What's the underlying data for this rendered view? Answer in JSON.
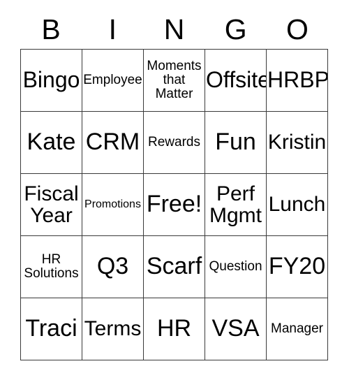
{
  "card": {
    "header_letters": [
      "B",
      "I",
      "N",
      "G",
      "O"
    ],
    "colors": {
      "background": "#ffffff",
      "text": "#000000",
      "border": "#3a3a3a"
    },
    "rows": [
      [
        {
          "text": "Bingo",
          "size": "lg"
        },
        {
          "text": "Employee",
          "size": "xs"
        },
        {
          "text": "Moments\nthat\nMatter",
          "size": "xs"
        },
        {
          "text": "Offsite",
          "size": "lg"
        },
        {
          "text": "HRBP",
          "size": "lg"
        }
      ],
      [
        {
          "text": "Kate",
          "size": "xl"
        },
        {
          "text": "CRM",
          "size": "xl"
        },
        {
          "text": "Rewards",
          "size": "xs"
        },
        {
          "text": "Fun",
          "size": "xl"
        },
        {
          "text": "Kristin",
          "size": "md"
        }
      ],
      [
        {
          "text": "Fiscal\nYear",
          "size": "md"
        },
        {
          "text": "Promotions",
          "size": "xxs"
        },
        {
          "text": "Free!",
          "size": "xl"
        },
        {
          "text": "Perf\nMgmt",
          "size": "md"
        },
        {
          "text": "Lunch",
          "size": "md"
        }
      ],
      [
        {
          "text": "HR\nSolutions",
          "size": "xs"
        },
        {
          "text": "Q3",
          "size": "xl"
        },
        {
          "text": "Scarf",
          "size": "xl"
        },
        {
          "text": "Question",
          "size": "xs"
        },
        {
          "text": "FY20",
          "size": "xl"
        }
      ],
      [
        {
          "text": "Traci",
          "size": "xl"
        },
        {
          "text": "Terms",
          "size": "md"
        },
        {
          "text": "HR",
          "size": "xl"
        },
        {
          "text": "VSA",
          "size": "xl"
        },
        {
          "text": "Manager",
          "size": "xs"
        }
      ]
    ]
  }
}
